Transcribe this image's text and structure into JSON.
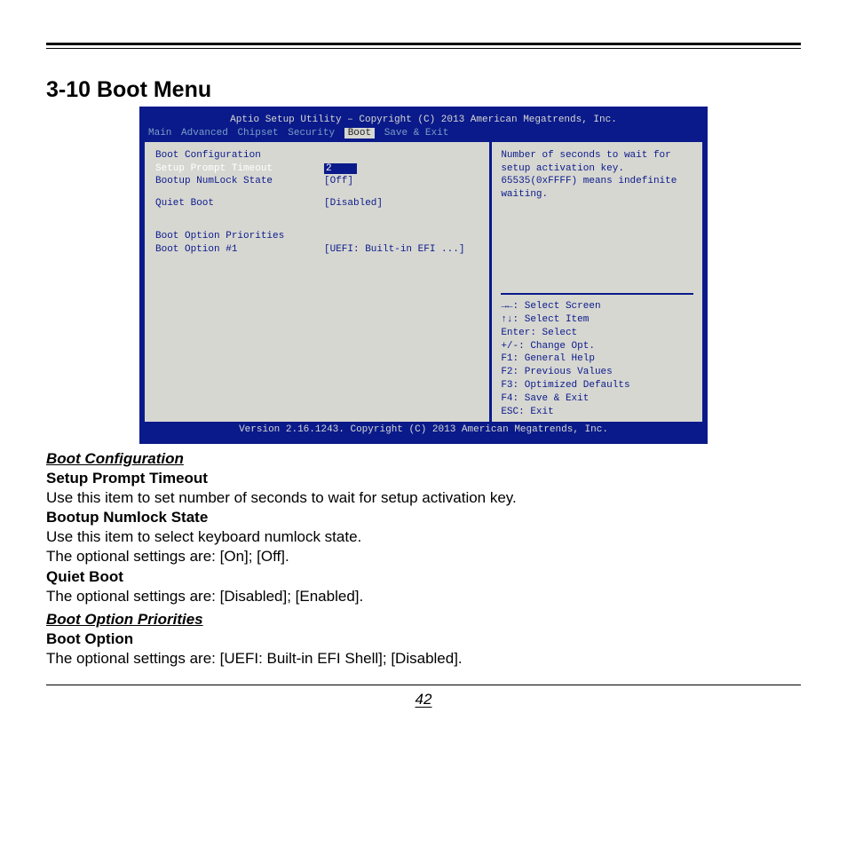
{
  "heading": "3-10 Boot Menu",
  "page_number": "42",
  "bios": {
    "title": "Aptio Setup Utility – Copyright (C) 2013 American Megatrends, Inc.",
    "footer": "Version 2.16.1243. Copyright (C) 2013 American Megatrends, Inc.",
    "menus": [
      "Main",
      "Advanced",
      "Chipset",
      "Security",
      "Boot",
      "Save & Exit"
    ],
    "selected_menu": "Boot",
    "left": {
      "section1": "Boot Configuration",
      "setup_prompt_label": "Setup Prompt Timeout",
      "setup_prompt_value": "2",
      "numlock_label": "Bootup NumLock State",
      "numlock_value": "[Off]",
      "quiet_label": "Quiet Boot",
      "quiet_value": "[Disabled]",
      "section2": "Boot Option Priorities",
      "bootopt_label": "Boot Option #1",
      "bootopt_value": "[UEFI: Built-in EFI ...]"
    },
    "help_text": "Number of seconds to wait for setup activation key. 65535(0xFFFF) means indefinite waiting.",
    "keys": [
      "→←: Select Screen",
      "↑↓: Select Item",
      "Enter: Select",
      "+/-: Change Opt.",
      "F1: General Help",
      "F2: Previous Values",
      "F3: Optimized Defaults",
      "F4: Save & Exit",
      "ESC: Exit"
    ]
  },
  "doc": {
    "h_boot_config": "Boot Configuration",
    "h_setup_prompt": "Setup Prompt Timeout",
    "t_setup_prompt": "Use this item to set number of seconds to wait for setup activation key.",
    "h_numlock": "Bootup Numlock State",
    "t_numlock1": "Use this item to select keyboard numlock state.",
    "t_numlock2": "The optional settings are: [On]; [Off].",
    "h_quiet": "Quiet Boot",
    "t_quiet": "The optional settings are: [Disabled]; [Enabled].",
    "h_boot_pri": "Boot Option Priorities",
    "h_boot_opt": "Boot Option",
    "t_boot_opt": "The optional settings are: [UEFI: Built-in EFI Shell]; [Disabled]."
  }
}
